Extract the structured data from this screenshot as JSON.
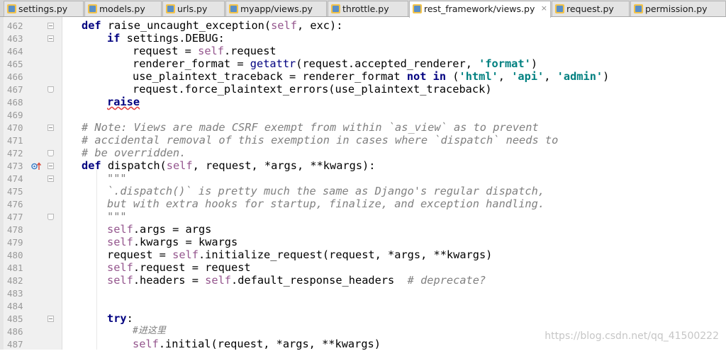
{
  "tabs": [
    {
      "label": "settings.py",
      "icon": "python-file-icon",
      "active": false
    },
    {
      "label": "models.py",
      "icon": "python-file-icon",
      "active": false
    },
    {
      "label": "urls.py",
      "icon": "python-file-icon",
      "active": false
    },
    {
      "label": "myapp/views.py",
      "icon": "python-file-icon",
      "active": false
    },
    {
      "label": "throttle.py",
      "icon": "python-file-icon",
      "active": false
    },
    {
      "label": "rest_framework/views.py",
      "icon": "python-file-icon",
      "active": true
    },
    {
      "label": "request.py",
      "icon": "python-file-icon",
      "active": false
    },
    {
      "label": "permission.py",
      "icon": "python-file-icon",
      "active": false
    }
  ],
  "tab_close_glyph": "×",
  "line_numbers": [
    "462",
    "463",
    "464",
    "465",
    "466",
    "467",
    "468",
    "469",
    "470",
    "471",
    "472",
    "473",
    "474",
    "475",
    "476",
    "477",
    "478",
    "479",
    "480",
    "481",
    "482",
    "483",
    "484",
    "485",
    "486",
    "487"
  ],
  "code": {
    "l462": {
      "kw1": "def",
      "fn": " raise_uncaught_exception(",
      "self": "self",
      "rest": ", exc):"
    },
    "l463": {
      "kw1": "if",
      "rest": " settings.DEBUG:"
    },
    "l464": {
      "a": "request = ",
      "self": "self",
      "b": ".request"
    },
    "l465": {
      "a": "renderer_format = ",
      "bi": "getattr",
      "b": "(request.accepted_renderer, ",
      "s1": "'format'",
      "c": ")"
    },
    "l466": {
      "a": "use_plaintext_traceback = renderer_format ",
      "kw": "not in",
      "b": " (",
      "s1": "'html'",
      "c": ", ",
      "s2": "'api'",
      "d": ", ",
      "s3": "'admin'",
      "e": ")"
    },
    "l467": {
      "a": "request.force_plaintext_errors(use_plaintext_traceback)"
    },
    "l468": {
      "kw": "raise"
    },
    "l470": {
      "c": "# Note: Views are made CSRF exempt from within `as_view` as to prevent"
    },
    "l471": {
      "c": "# accidental removal of this exemption in cases where `dispatch` needs to"
    },
    "l472": {
      "c": "# be overridden."
    },
    "l473": {
      "kw1": "def",
      "fn": " dispatch(",
      "self": "self",
      "rest": ", request, *args, **kwargs):"
    },
    "l474": {
      "d": "\"\"\""
    },
    "l475": {
      "d": "`.dispatch()` is pretty much the same as Django's regular dispatch,"
    },
    "l476": {
      "d": "but with extra hooks for startup, finalize, and exception handling."
    },
    "l477": {
      "d": "\"\"\""
    },
    "l478": {
      "self": "self",
      "rest": ".args = args"
    },
    "l479": {
      "self": "self",
      "rest": ".kwargs = kwargs"
    },
    "l480": {
      "a": "request = ",
      "self": "self",
      "b": ".initialize_request(request, *args, **kwargs)"
    },
    "l481": {
      "self": "self",
      "rest": ".request = request"
    },
    "l482": {
      "self": "self",
      "a": ".headers = ",
      "self2": "self",
      "b": ".default_response_headers  ",
      "c": "# deprecate?"
    },
    "l485": {
      "kw": "try",
      "rest": ":"
    },
    "l486": {
      "c": "#进这里"
    },
    "l487": {
      "self": "self",
      "rest": ".initial(request, *args, **kwargs)"
    }
  },
  "watermark": "https://blog.csdn.net/qq_41500222",
  "colors": {
    "keyword": "#000080",
    "self": "#94558d",
    "string": "#008080",
    "comment": "#808080",
    "background": "#ffffff",
    "gutter": "#f0f0f0"
  }
}
